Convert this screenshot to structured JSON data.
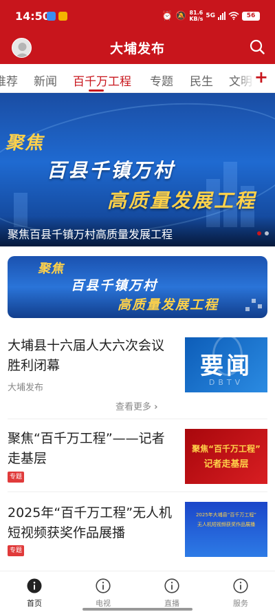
{
  "status_bar": {
    "time": "14:50",
    "speed_value": "81.6",
    "speed_unit": "KB/s",
    "signal": "5G",
    "battery": "56"
  },
  "header": {
    "title": "大埔发布"
  },
  "tabs": [
    {
      "label": "推荐",
      "active": false
    },
    {
      "label": "新闻",
      "active": false
    },
    {
      "label": "百千万工程",
      "active": true
    },
    {
      "label": "专题",
      "active": false
    },
    {
      "label": "民生",
      "active": false
    },
    {
      "label": "文明",
      "active": false
    }
  ],
  "hero": {
    "line1": "聚焦",
    "line2": "百县千镇万村",
    "line3": "高质量发展工程",
    "caption": "聚焦百县千镇万村高质量发展工程"
  },
  "banner2": {
    "line1": "聚焦",
    "line2": "百县千镇万村",
    "line3": "高质量发展工程"
  },
  "news": [
    {
      "title": "大埔县十六届人大六次会议胜利闭幕",
      "source": "大埔发布",
      "thumb_main": "要闻",
      "thumb_sub": "DBTV"
    },
    {
      "title": "聚焦“百千万工程”——记者走基层",
      "tag": "专题",
      "thumb_line1": "聚焦“百千万工程”",
      "thumb_line2": "记者走基层"
    },
    {
      "title": "2025年“百千万工程”无人机短视频获奖作品展播",
      "tag": "专题",
      "thumb_line1": "2025年大埔县“百千万工程”",
      "thumb_line2": "无人机短视频获奖作品展播"
    }
  ],
  "more": {
    "label": "查看更多"
  },
  "bottom_nav": [
    {
      "label": "首页",
      "active": true
    },
    {
      "label": "电视",
      "active": false
    },
    {
      "label": "直播",
      "active": false
    },
    {
      "label": "服务",
      "active": false
    }
  ],
  "colors": {
    "brand_red": "#c8151c",
    "banner_blue": "#1f6ad1",
    "accent_gold": "#ffd24a",
    "tag_red": "#e03a3a"
  }
}
